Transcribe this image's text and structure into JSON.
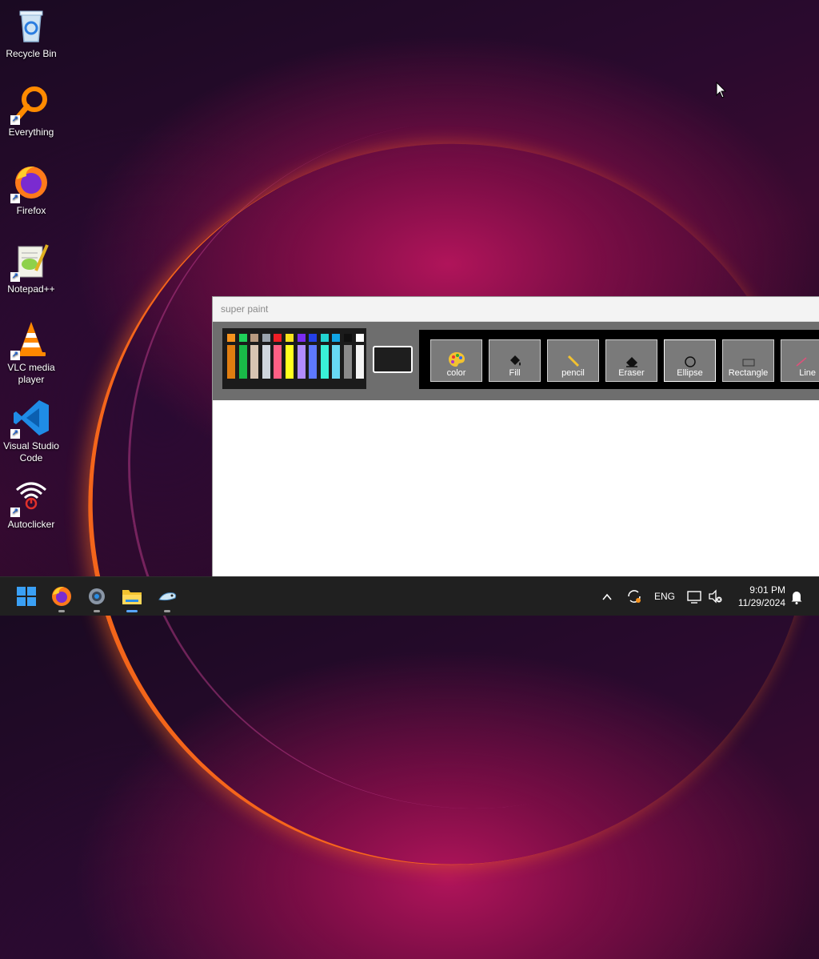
{
  "desktop": {
    "icons": [
      {
        "label": "Recycle Bin",
        "icon": "recycle-bin-icon"
      },
      {
        "label": "Everything",
        "icon": "search-magnifier-icon"
      },
      {
        "label": "Firefox",
        "icon": "firefox-icon"
      },
      {
        "label": "Notepad++",
        "icon": "notepad-plus-plus-icon"
      },
      {
        "label": "VLC media player",
        "icon": "vlc-cone-icon"
      },
      {
        "label": "Visual Studio Code",
        "icon": "vscode-icon"
      },
      {
        "label": "Autoclicker",
        "icon": "autoclicker-wifi-icon"
      }
    ]
  },
  "paint": {
    "title": "super paint",
    "current_color": "#1e1e1e",
    "palette": [
      {
        "top": "#f7931e",
        "bar": "#e07d10"
      },
      {
        "top": "#1fd15a",
        "bar": "#19b948"
      },
      {
        "top": "#b89a80",
        "bar": "#d7c4b2"
      },
      {
        "top": "#9aa3ad",
        "bar": "#cfd6dd"
      },
      {
        "top": "#ef1e25",
        "bar": "#ff5f84"
      },
      {
        "top": "#f7e21b",
        "bar": "#ffff1e"
      },
      {
        "top": "#7b2cf2",
        "bar": "#b18cff"
      },
      {
        "top": "#2440e8",
        "bar": "#5e79ff"
      },
      {
        "top": "#22d3d0",
        "bar": "#39f0d6"
      },
      {
        "top": "#11a6e6",
        "bar": "#67d8f3"
      },
      {
        "top": "#101010",
        "bar": "#8a8a8a"
      },
      {
        "top": "#ffffff",
        "bar": "#f4f4f4"
      }
    ],
    "tools": [
      {
        "label": "color",
        "icon": "palette-icon"
      },
      {
        "label": "Fill",
        "icon": "paint-bucket-icon"
      },
      {
        "label": "pencil",
        "icon": "pencil-icon"
      },
      {
        "label": "Eraser",
        "icon": "eraser-icon"
      },
      {
        "label": "Ellipse",
        "icon": "ellipse-icon"
      },
      {
        "label": "Rectangle",
        "icon": "rectangle-icon"
      },
      {
        "label": "Line",
        "icon": "line-icon"
      }
    ]
  },
  "taskbar": {
    "apps": [
      {
        "name": "Start",
        "icon": "windows-start-icon"
      },
      {
        "name": "Firefox",
        "icon": "firefox-icon"
      },
      {
        "name": "Settings",
        "icon": "gear-icon"
      },
      {
        "name": "File Explorer",
        "icon": "folder-icon"
      },
      {
        "name": "super paint",
        "icon": "paint-app-icon"
      }
    ],
    "tray": {
      "language": "ENG",
      "time": "9:01 PM",
      "date": "11/29/2024"
    }
  }
}
